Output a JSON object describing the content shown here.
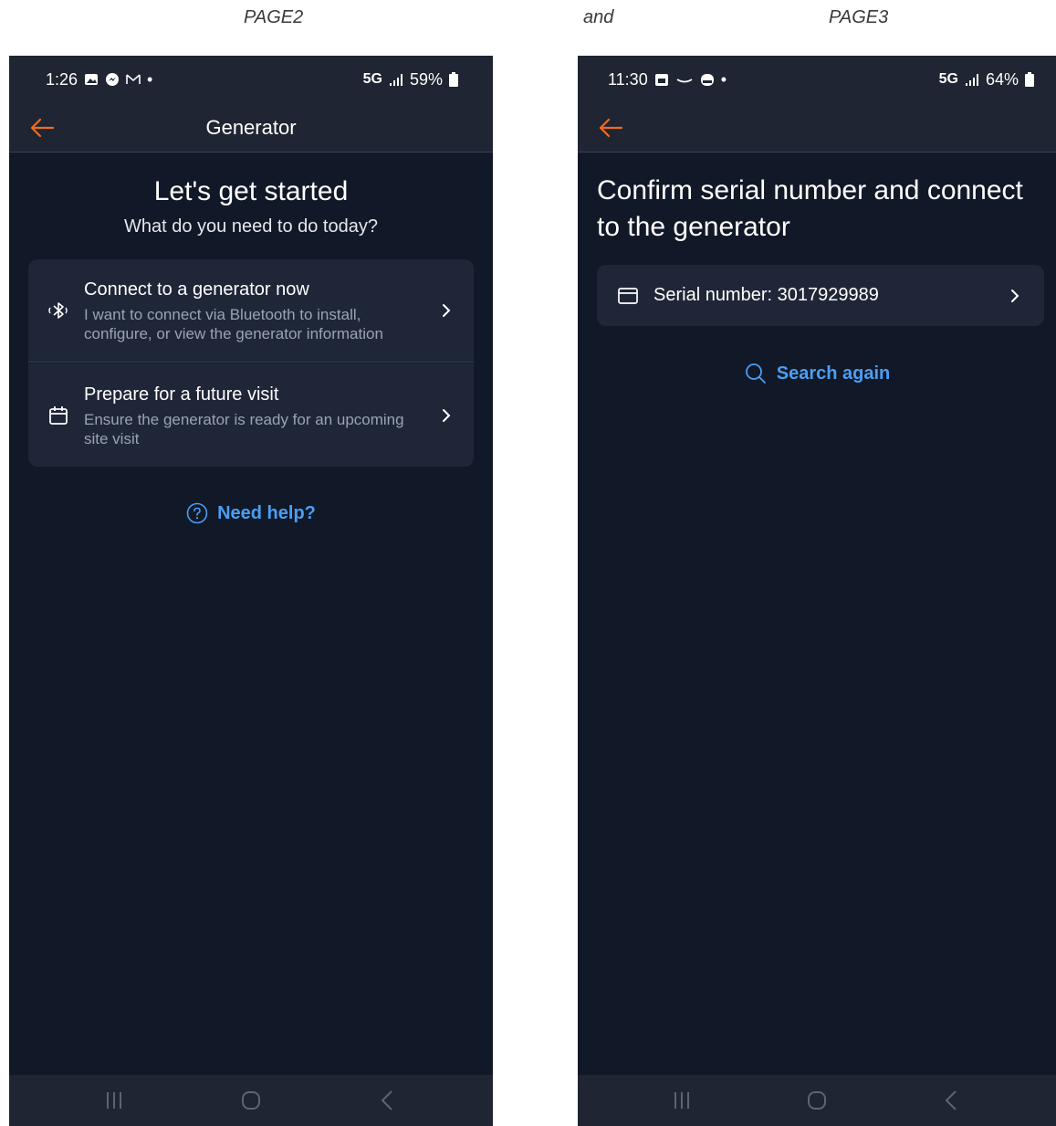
{
  "captions": {
    "left": "PAGE2",
    "middle": "and",
    "right": "PAGE3"
  },
  "page2": {
    "status": {
      "time": "1:26",
      "dot": "•",
      "network": "5G",
      "battery": "59%"
    },
    "header": {
      "title": "Generator"
    },
    "heading": "Let's get started",
    "subheading": "What do you need to do today?",
    "options": [
      {
        "title": "Connect to a generator now",
        "description": "I want to connect via Bluetooth to install, configure, or view the generator information",
        "icon": "bluetooth-icon"
      },
      {
        "title": "Prepare for a future visit",
        "description": "Ensure the generator is ready for an upcoming site visit",
        "icon": "calendar-icon"
      }
    ],
    "help_label": "Need help?"
  },
  "page3": {
    "status": {
      "time": "11:30",
      "dot": "•",
      "network": "5G",
      "battery": "64%"
    },
    "heading": "Confirm serial number and connect to the generator",
    "serial_label": "Serial number: 3017929989",
    "search_again_label": "Search again"
  },
  "colors": {
    "background": "#111827",
    "bar": "#1f2532",
    "card": "#1f2637",
    "accent": "#f26b1d",
    "link": "#4a9ff5"
  }
}
